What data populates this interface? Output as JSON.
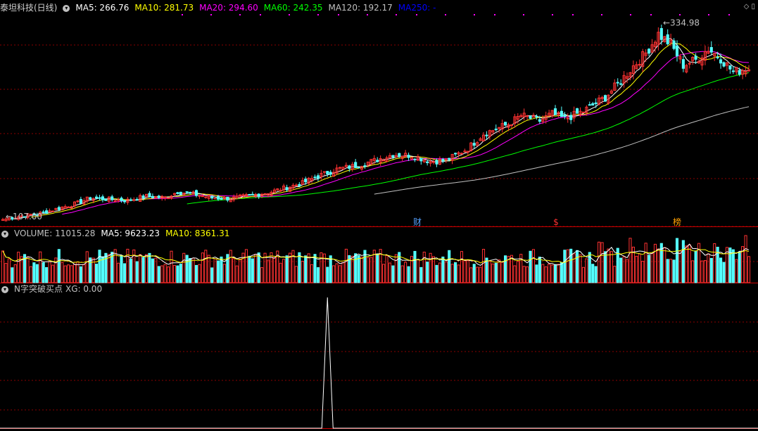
{
  "header": {
    "title": "泰坦科技(日线)",
    "ma5": "MA5: 266.76",
    "ma10": "MA10: 281.73",
    "ma20": "MA20: 294.60",
    "ma60": "MA60: 242.35",
    "ma120": "MA120: 192.17",
    "ma250": "MA250: -"
  },
  "volume_header": {
    "title": "VOLUME: 11015.28",
    "ma5": "MA5: 9623.23",
    "ma10": "MA10: 8361.31"
  },
  "indicator_header": {
    "title": "N字突破买点",
    "xg": "XG: 0.00"
  },
  "annotations": {
    "high_label": "334.98",
    "low_label": "107.00",
    "marker_cai": "财",
    "marker_dollar": "$",
    "marker_rank": "榜"
  },
  "colors": {
    "up": "#ff3232",
    "down": "#54ffff",
    "ma5": "#ffffff",
    "ma10": "#ffff00",
    "ma20": "#ff00ff",
    "ma60": "#00ff00",
    "ma120": "#c0c0c0",
    "ma250": "#0000ff",
    "grid": "#8b0000"
  },
  "chart_data": [
    {
      "type": "candlestick",
      "title": "泰坦科技(日线)",
      "y_range": [
        100,
        345
      ],
      "price_high": 334.98,
      "price_low": 107.0,
      "close_anchors": [
        [
          0,
          108
        ],
        [
          6,
          112
        ],
        [
          12,
          115
        ],
        [
          18,
          121
        ],
        [
          24,
          127
        ],
        [
          28,
          133
        ],
        [
          35,
          131
        ],
        [
          40,
          130
        ],
        [
          46,
          135
        ],
        [
          52,
          133
        ],
        [
          56,
          140
        ],
        [
          60,
          138
        ],
        [
          67,
          133
        ],
        [
          73,
          132
        ],
        [
          80,
          136
        ],
        [
          86,
          140
        ],
        [
          90,
          144
        ],
        [
          96,
          150
        ],
        [
          101,
          158
        ],
        [
          107,
          166
        ],
        [
          113,
          170
        ],
        [
          119,
          176
        ],
        [
          125,
          183
        ],
        [
          131,
          182
        ],
        [
          137,
          175
        ],
        [
          142,
          176
        ],
        [
          149,
          190
        ],
        [
          154,
          207
        ],
        [
          162,
          218
        ],
        [
          166,
          228
        ],
        [
          172,
          222
        ],
        [
          176,
          230
        ],
        [
          180,
          224
        ],
        [
          186,
          233
        ],
        [
          193,
          249
        ],
        [
          198,
          268
        ],
        [
          202,
          285
        ],
        [
          206,
          300
        ],
        [
          210,
          322
        ],
        [
          214,
          310
        ],
        [
          218,
          286
        ],
        [
          222,
          292
        ],
        [
          226,
          305
        ],
        [
          230,
          294
        ],
        [
          234,
          278
        ],
        [
          238,
          282
        ]
      ],
      "markers": [
        "财",
        "$",
        "榜"
      ]
    },
    {
      "type": "bar",
      "title": "VOLUME: 11015.28",
      "series": [
        {
          "name": "MA5",
          "value": 9623.23
        },
        {
          "name": "MA10",
          "value": 8361.31
        }
      ],
      "last_volume": 11015.28
    },
    {
      "type": "line",
      "title": "N字突破买点",
      "series": [
        {
          "name": "XG",
          "value": 0.0
        }
      ],
      "signal_index": 104
    }
  ]
}
